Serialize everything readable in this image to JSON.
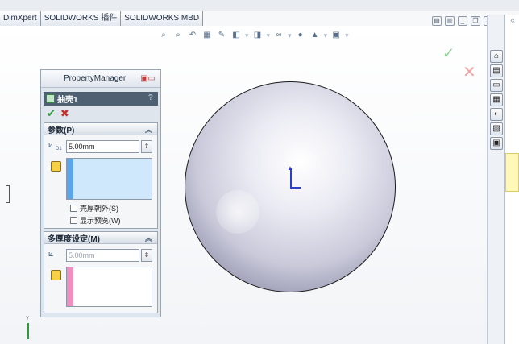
{
  "tabs": [
    "DimXpert",
    "SOLIDWORKS 插件",
    "SOLIDWORKS MBD"
  ],
  "property_manager": {
    "title": "PropertyManager",
    "feature_name": "抽壳1",
    "feature_help": "?",
    "ok_symbol": "✔",
    "cancel_symbol": "✖",
    "params": {
      "header": "参数(P)",
      "thickness_value": "5.00mm",
      "thickness_unit_label": "D1",
      "shell_outward_label": "壳厚朝外(S)",
      "show_preview_label": "显示预览(W)"
    },
    "multi": {
      "header": "多厚度设定(M)",
      "thickness_value": "5.00mm"
    }
  },
  "colors": {
    "face_selection_blue": "#cfe8fb",
    "face_selection_pink": "#ee8fbf",
    "feature_bar": "#4e6072"
  },
  "icons": {
    "ok_graphics": "✓",
    "cancel_graphics": "✕"
  }
}
